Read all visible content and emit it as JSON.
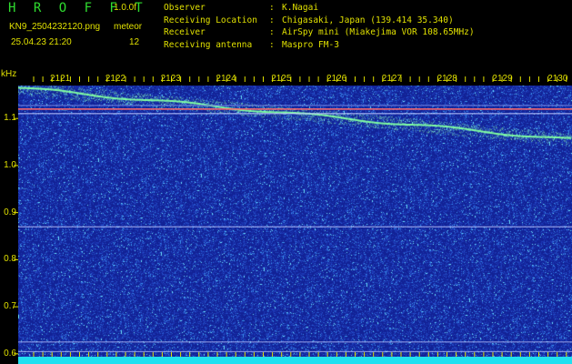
{
  "header": {
    "app_title": "H R O F F T",
    "version": "1.0.0f",
    "filename": "KN9_2504232120.png",
    "mode": "meteor",
    "datetime": "25.04.23 21:20",
    "count": "12"
  },
  "info": [
    {
      "key": "Observer",
      "sep": ":",
      "value": "K.Nagai"
    },
    {
      "key": "Receiving Location",
      "sep": ":",
      "value": "Chigasaki, Japan (139.414 35.340)"
    },
    {
      "key": "Receiver",
      "sep": ":",
      "value": "AirSpy mini (Miakejima VOR 108.65MHz)"
    },
    {
      "key": "Receiving antenna",
      "sep": ":",
      "value": "Maspro FM-3"
    }
  ],
  "chart_data": {
    "type": "heatmap",
    "ylabel": "kHz",
    "x_ticks": [
      "2121",
      "2122",
      "2123",
      "2124",
      "2125",
      "2126",
      "2127",
      "2128",
      "2129",
      "2130"
    ],
    "y_ticks": [
      "1.1",
      "1.0",
      "0.9",
      "0.8",
      "0.7",
      "0.6"
    ],
    "ylim": [
      0.59,
      1.17
    ],
    "colors": {
      "background": "#1a2aa0",
      "noise_hi": "#4fd8ff",
      "trace": "#7fffa0",
      "ref_line": "#ff6a6a",
      "bottom_bar": "#20e0f0"
    }
  }
}
